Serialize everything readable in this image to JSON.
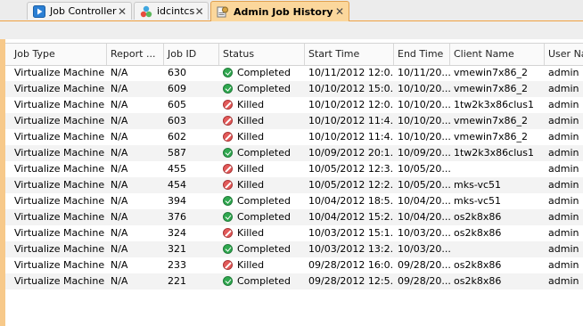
{
  "tabs": [
    {
      "label": "Job Controller",
      "icon": "play-icon"
    },
    {
      "label": "idcintcs",
      "icon": "commcell-icon"
    },
    {
      "label": "Admin Job History",
      "icon": "admin-job-history-icon",
      "active": true
    }
  ],
  "table": {
    "columns": [
      "Job Type",
      "Report ...",
      "Job ID",
      "Status",
      "Start Time",
      "End Time",
      "Client Name",
      "User Name"
    ],
    "rows": [
      {
        "job_type": "Virtualize Machine",
        "report": "N/A",
        "job_id": "630",
        "status": "Completed",
        "start": "10/11/2012 12:0...",
        "end": "10/11/20...",
        "client": "vmewin7x86_2",
        "user": "admin"
      },
      {
        "job_type": "Virtualize Machine",
        "report": "N/A",
        "job_id": "609",
        "status": "Completed",
        "start": "10/10/2012 15:0...",
        "end": "10/10/20...",
        "client": "vmewin7x86_2",
        "user": "admin"
      },
      {
        "job_type": "Virtualize Machine",
        "report": "N/A",
        "job_id": "605",
        "status": "Killed",
        "start": "10/10/2012 12:0...",
        "end": "10/10/20...",
        "client": "1tw2k3x86clus1",
        "user": "admin"
      },
      {
        "job_type": "Virtualize Machine",
        "report": "N/A",
        "job_id": "603",
        "status": "Killed",
        "start": "10/10/2012 11:4...",
        "end": "10/10/20...",
        "client": "vmewin7x86_2",
        "user": "admin"
      },
      {
        "job_type": "Virtualize Machine",
        "report": "N/A",
        "job_id": "602",
        "status": "Killed",
        "start": "10/10/2012 11:4...",
        "end": "10/10/20...",
        "client": "vmewin7x86_2",
        "user": "admin"
      },
      {
        "job_type": "Virtualize Machine",
        "report": "N/A",
        "job_id": "587",
        "status": "Completed",
        "start": "10/09/2012 20:1...",
        "end": "10/09/20...",
        "client": "1tw2k3x86clus1",
        "user": "admin"
      },
      {
        "job_type": "Virtualize Machine",
        "report": "N/A",
        "job_id": "455",
        "status": "Killed",
        "start": "10/05/2012 12:3...",
        "end": "10/05/20...",
        "client": "",
        "user": "admin"
      },
      {
        "job_type": "Virtualize Machine",
        "report": "N/A",
        "job_id": "454",
        "status": "Killed",
        "start": "10/05/2012 12:2...",
        "end": "10/05/20...",
        "client": "mks-vc51",
        "user": "admin"
      },
      {
        "job_type": "Virtualize Machine",
        "report": "N/A",
        "job_id": "394",
        "status": "Completed",
        "start": "10/04/2012 18:5...",
        "end": "10/04/20...",
        "client": "mks-vc51",
        "user": "admin"
      },
      {
        "job_type": "Virtualize Machine",
        "report": "N/A",
        "job_id": "376",
        "status": "Completed",
        "start": "10/04/2012 15:2...",
        "end": "10/04/20...",
        "client": "os2k8x86",
        "user": "admin"
      },
      {
        "job_type": "Virtualize Machine",
        "report": "N/A",
        "job_id": "324",
        "status": "Killed",
        "start": "10/03/2012 15:1...",
        "end": "10/03/20...",
        "client": "os2k8x86",
        "user": "admin"
      },
      {
        "job_type": "Virtualize Machine",
        "report": "N/A",
        "job_id": "321",
        "status": "Completed",
        "start": "10/03/2012 13:2...",
        "end": "10/03/20...",
        "client": "",
        "user": "admin"
      },
      {
        "job_type": "Virtualize Machine",
        "report": "N/A",
        "job_id": "233",
        "status": "Killed",
        "start": "09/28/2012 16:0...",
        "end": "09/28/20...",
        "client": "os2k8x86",
        "user": "admin"
      },
      {
        "job_type": "Virtualize Machine",
        "report": "N/A",
        "job_id": "221",
        "status": "Completed",
        "start": "09/28/2012 12:5...",
        "end": "09/28/20...",
        "client": "os2k8x86",
        "user": "admin"
      }
    ]
  },
  "colors": {
    "active_tab": "#fbd79c",
    "accent_border": "#f0a040",
    "completed": "#2fa84f",
    "killed": "#e35a5a"
  }
}
